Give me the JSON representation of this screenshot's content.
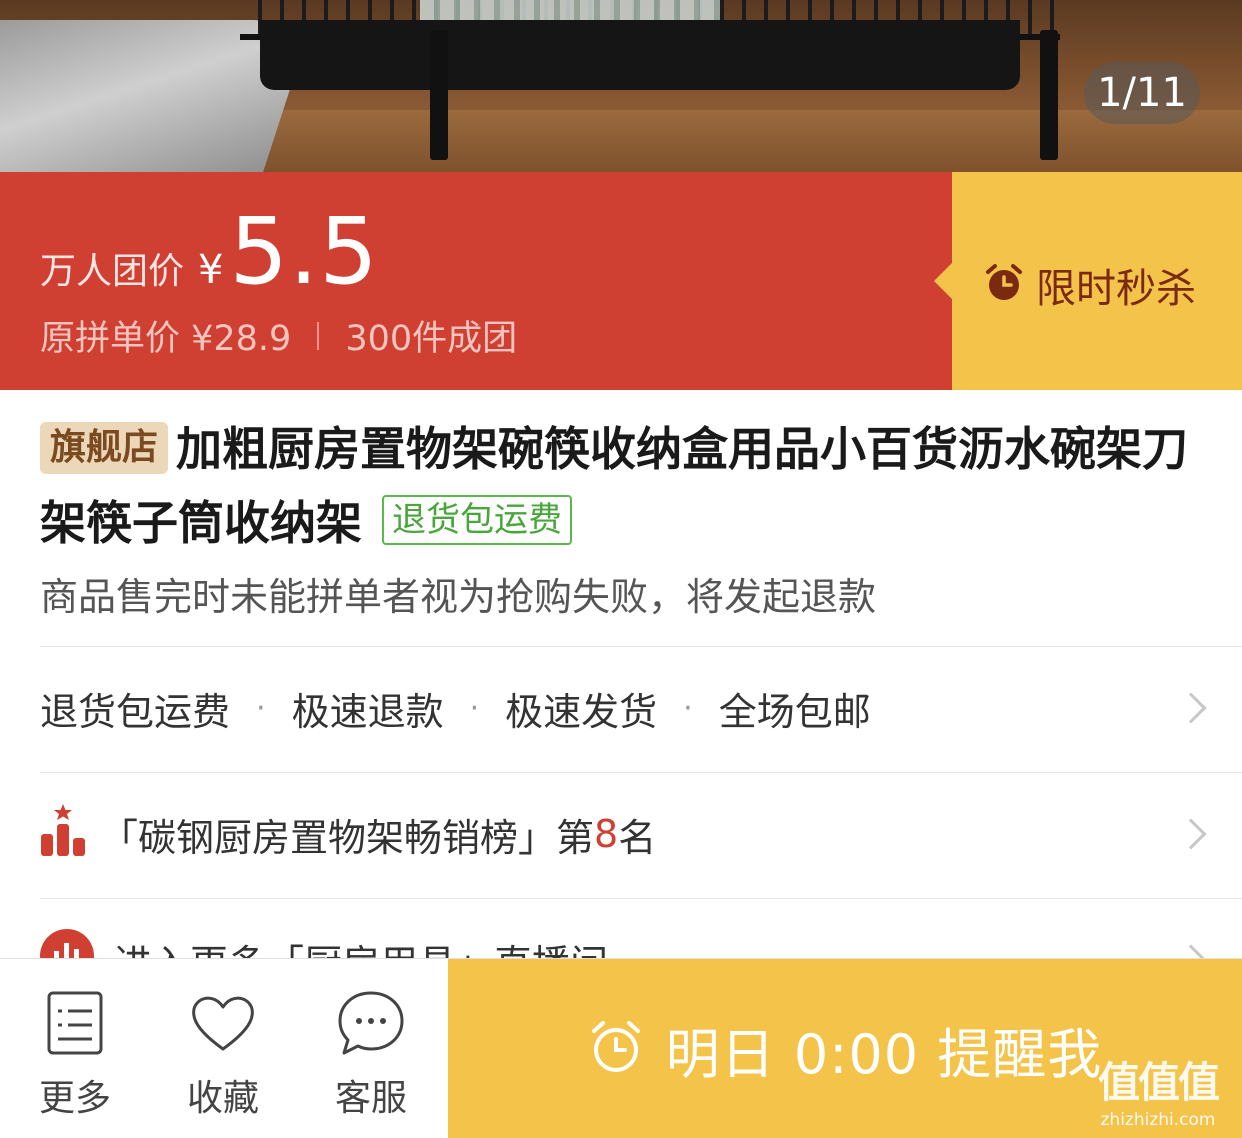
{
  "gallery": {
    "indicator": "1/11"
  },
  "price": {
    "label": "万人团价",
    "currency": "¥",
    "value": "5.5",
    "original_label": "原拼单价 ¥28.9",
    "group_count": "300件成团"
  },
  "flash": {
    "label": "限时秒杀",
    "icon": "alarm-clock-icon"
  },
  "product": {
    "flagship_tag": "旗舰店",
    "title": "加粗厨房置物架碗筷收纳盒用品小百货沥水碗架刀架筷子筒收纳架",
    "return_tag": "退货包运费",
    "notice": "商品售完时未能拼单者视为抢购失败，将发起退款"
  },
  "services": [
    "退货包运费",
    "极速退款",
    "极速发货",
    "全场包邮"
  ],
  "ranking": {
    "prefix": "「碳钢厨房置物架畅销榜」第",
    "rank": "8",
    "suffix": "名"
  },
  "live": {
    "text": "进入更多「厨房用具」直播间"
  },
  "bottom_bar": {
    "more_label": "更多",
    "favorite_label": "收藏",
    "service_label": "客服",
    "remind_label": "明日 0:00 提醒我"
  },
  "watermark": {
    "main": "值值值",
    "sub": "zhizhizhi.com"
  },
  "colors": {
    "price_red": "#d04032",
    "flash_yellow": "#f4c34a",
    "return_green": "#4aa53c",
    "flagship_bg": "#ecd8b8"
  }
}
